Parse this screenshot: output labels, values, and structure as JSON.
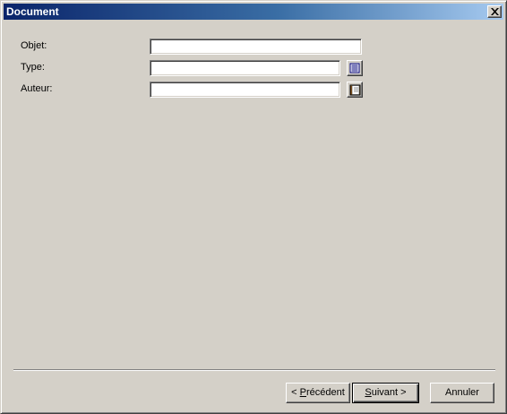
{
  "window": {
    "title": "Document"
  },
  "form": {
    "fields": [
      {
        "label": "Objet:",
        "value": ""
      },
      {
        "label": "Type:",
        "value": ""
      },
      {
        "label": "Auteur:",
        "value": ""
      }
    ]
  },
  "buttons": {
    "previous": {
      "prefix": "< ",
      "mnemonic": "P",
      "rest": "récédent"
    },
    "next": {
      "mnemonic": "S",
      "rest": "uivant",
      "suffix": " >"
    },
    "cancel": {
      "label": "Annuler"
    }
  },
  "icons": {
    "type_lookup": "list-icon",
    "author_lookup": "book-icon"
  }
}
